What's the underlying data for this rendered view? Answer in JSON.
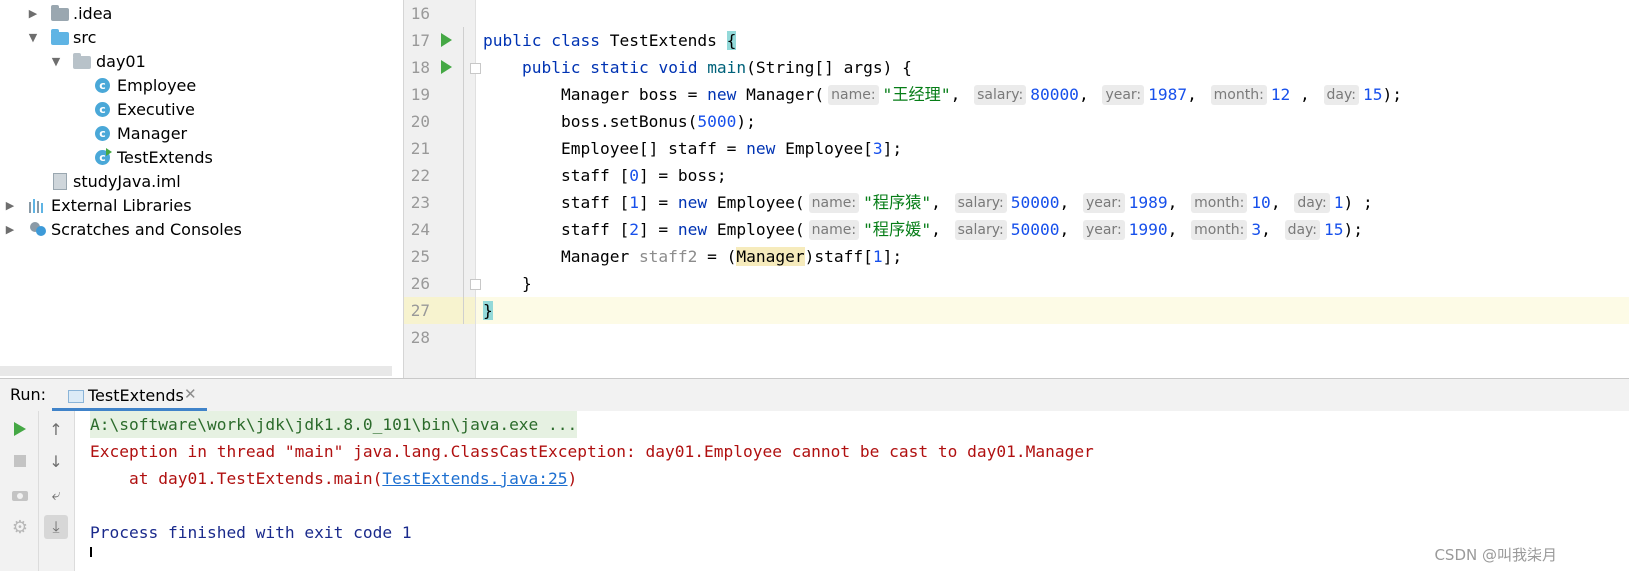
{
  "project_tree": {
    "items": [
      {
        "label": ".idea",
        "icon": "folder-icon",
        "arrow": "▶"
      },
      {
        "label": "src",
        "icon": "source-folder-icon",
        "arrow": "▼"
      },
      {
        "label": "day01",
        "icon": "package-icon",
        "arrow": "▼"
      },
      {
        "label": "Employee",
        "icon": "class-icon"
      },
      {
        "label": "Executive",
        "icon": "class-icon"
      },
      {
        "label": "Manager",
        "icon": "class-icon"
      },
      {
        "label": "TestExtends",
        "icon": "runnable-class-icon"
      },
      {
        "label": "studyJava.iml",
        "icon": "module-file-icon"
      },
      {
        "label": "External Libraries",
        "icon": "libraries-icon",
        "arrow": "▶"
      },
      {
        "label": "Scratches and Consoles",
        "icon": "scratches-icon",
        "arrow": "▶"
      }
    ]
  },
  "editor": {
    "line_numbers": [
      "16",
      "17",
      "18",
      "19",
      "20",
      "21",
      "22",
      "23",
      "24",
      "25",
      "26",
      "27",
      "28"
    ]
  },
  "run_panel": {
    "title": "Run:",
    "tab_label": "TestExtends",
    "console_lines": {
      "command": "A:\\software\\work\\jdk\\jdk1.8.0_101\\bin\\java.exe ...",
      "exception": "Exception in thread \"main\" java.lang.ClassCastException: day01.Employee cannot be cast to day01.Manager",
      "at_prefix": "    at day01.TestExtends.main(",
      "at_link": "TestExtends.java:25",
      "at_suffix": ")",
      "finished": "Process finished with exit code 1"
    }
  },
  "watermark": "CSDN @叫我柒月",
  "colors": {
    "keyword": "#0033b3",
    "string": "#067d17",
    "number": "#1750eb",
    "error": "#b01010",
    "link": "#1d6fd0",
    "run_green": "#45a845"
  }
}
